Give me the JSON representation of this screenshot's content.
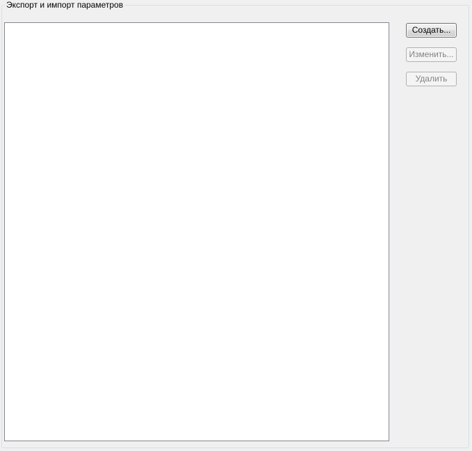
{
  "group": {
    "caption": "Экспорт и импорт параметров"
  },
  "list": {
    "items": []
  },
  "buttons": {
    "create": {
      "label": "Создать...",
      "enabled": true
    },
    "edit": {
      "label": "Изменить...",
      "enabled": false
    },
    "delete": {
      "label": "Удалить",
      "enabled": false
    }
  }
}
